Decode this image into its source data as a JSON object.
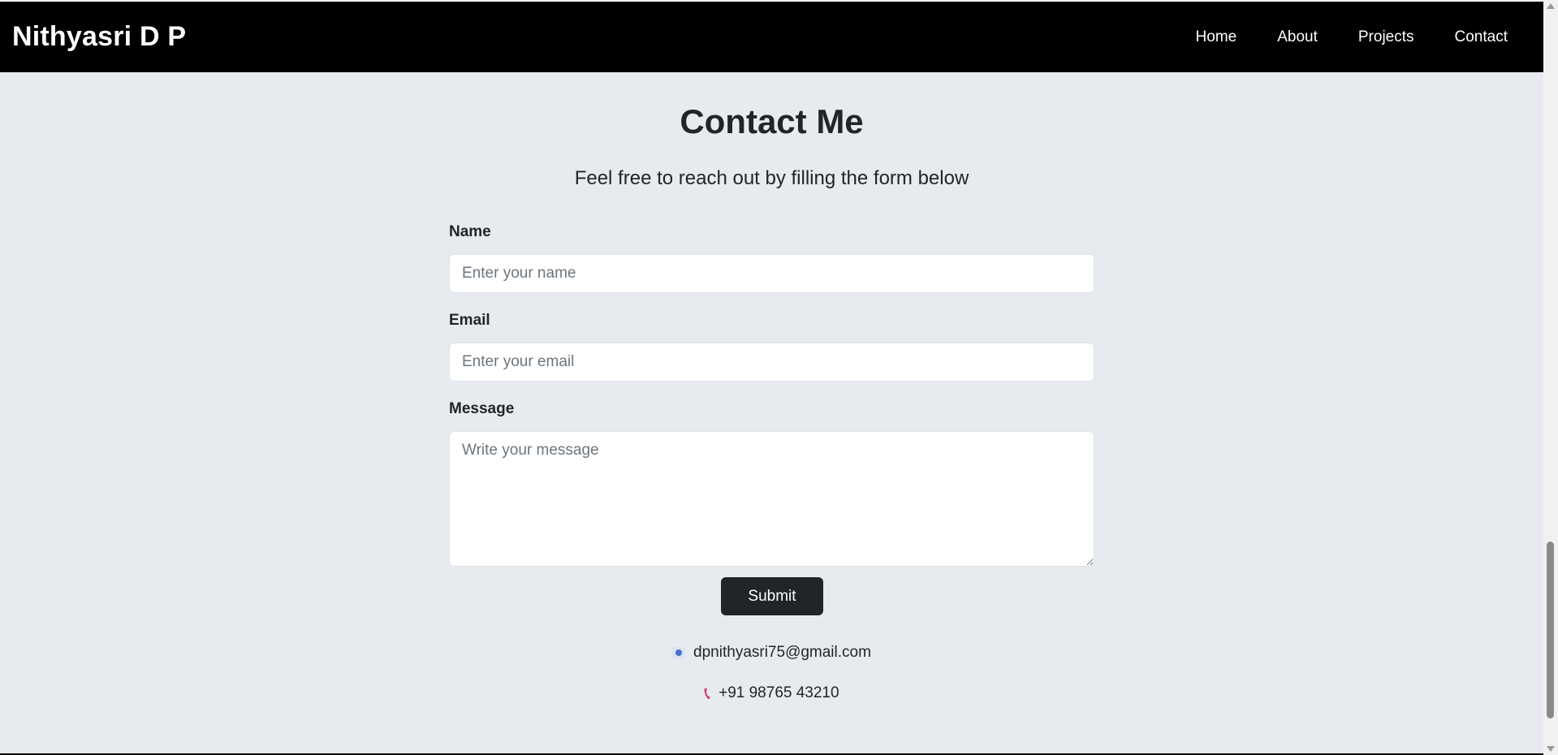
{
  "navbar": {
    "brand": "Nithyasri D P",
    "links": [
      "Home",
      "About",
      "Projects",
      "Contact"
    ],
    "background": "#000000"
  },
  "contact": {
    "title": "Contact Me",
    "subtitle": "Feel free to reach out by filling the form below",
    "form": {
      "name_label": "Name",
      "name_placeholder": "Enter your name",
      "email_label": "Email",
      "email_placeholder": "Enter your email",
      "message_label": "Message",
      "message_placeholder": "Write your message",
      "submit_label": "Submit"
    },
    "email": "dpnithyasri75@gmail.com",
    "phone": "+91 98765 43210",
    "email_icon": "mail-icon",
    "phone_icon": "phone-icon"
  },
  "colors": {
    "page_background": "#e7ebef",
    "button_background": "#212529",
    "phone_icon": "#d6336c"
  }
}
